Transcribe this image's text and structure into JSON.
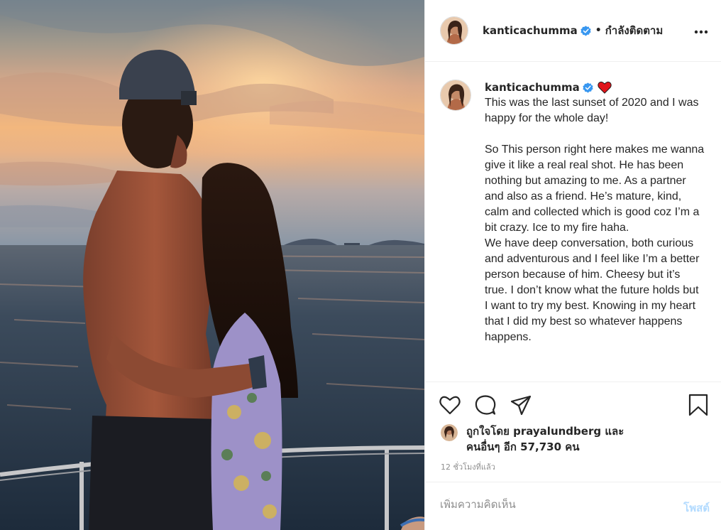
{
  "post": {
    "username": "kanticachumma",
    "follow_label": "กำลังติดตาม",
    "more_icon": "more-horizontal-icon",
    "caption": "This was the last sunset of 2020 and I was happy for the whole day!\n\nSo This person right here makes me wanna give it like a real real shot. He has been nothing but amazing to me. As a partner and also as a friend. He’s mature, kind, calm and collected which is good coz I’m a bit crazy. Ice to my fire haha.\nWe have deep conversation, both curious and adventurous and I feel like I’m a better person because of him. Cheesy but it’s true. I don’t know what the future holds but I want to try my best. Knowing in my heart that I did my best so whatever happens happens.",
    "likes": {
      "prefix": "ถูกใจโดย",
      "user": "prayalundberg",
      "conj": "และ",
      "others": "คนอื่นๆ อีก 57,730 คน"
    },
    "timestamp": "12 ชั่วโมงที่แล้ว",
    "comment_placeholder": "เพิ่มความคิดเห็น",
    "post_label": "โพสต์",
    "colors": {
      "verified": "#3897f0",
      "heart": "#e0151b",
      "post_button_disabled": "#b3dbff",
      "muted": "#8e8e8e"
    },
    "icons": [
      "heart-icon",
      "comment-icon",
      "share-icon",
      "bookmark-icon",
      "verified-badge-icon",
      "red-heart-emoji"
    ]
  }
}
